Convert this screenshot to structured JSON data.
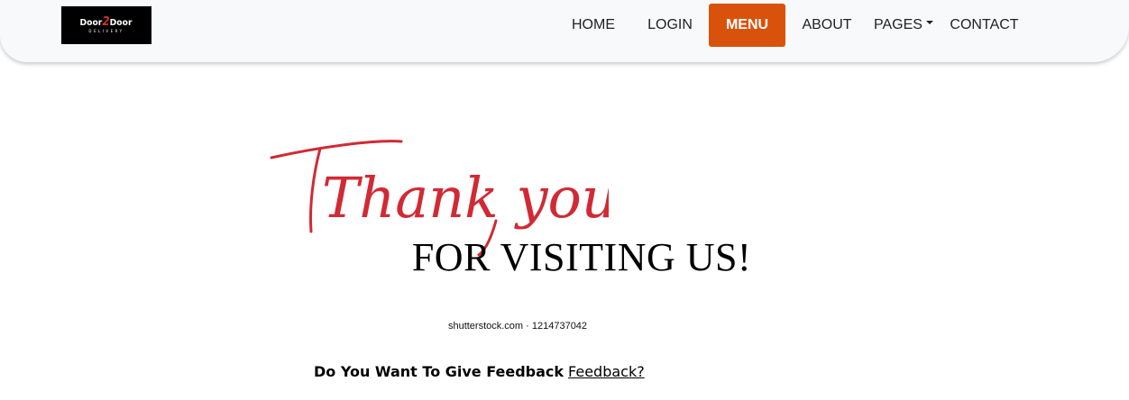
{
  "navbar": {
    "logo": {
      "main_left": "Door",
      "main_mid": "2",
      "main_right": "Door",
      "sub": "DELIVERY"
    },
    "items": [
      {
        "label": "HOME"
      },
      {
        "label": "LOGIN"
      },
      {
        "label": "MENU",
        "active": true
      },
      {
        "label": "ABOUT"
      },
      {
        "label": "PAGES",
        "has_dropdown": true
      },
      {
        "label": "CONTACT"
      }
    ],
    "active_color": "#d9520c"
  },
  "hero": {
    "script_text": "Thank you",
    "script_color": "#d12a35",
    "headline": "FOR VISITING US!",
    "watermark": "shutterstock.com · 1214737042"
  },
  "feedback": {
    "question": "Do You Want To Give Feedback",
    "link_label": "Feedback?"
  }
}
